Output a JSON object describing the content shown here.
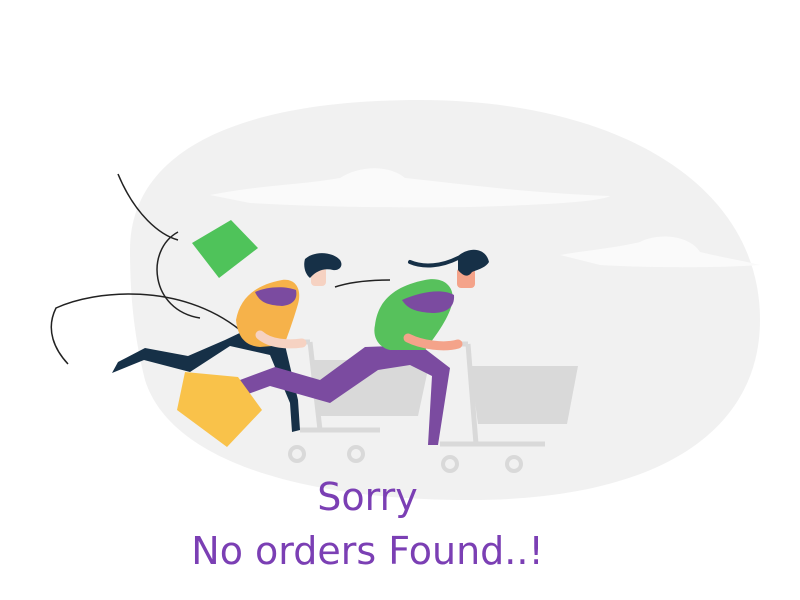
{
  "message": {
    "line1": "Sorry",
    "line2": "No orders Found..!"
  },
  "colors": {
    "accent_text": "#7b3fb4",
    "background_blob": "#f1f1f1",
    "cart": "#d9d9d9",
    "green_shirt": "#57c15c",
    "orange_shirt": "#f6b24a",
    "purple_pants": "#7b4ba0",
    "navy_pants": "#163047",
    "skin": "#f4a38a",
    "yellow_bag": "#f9c24a",
    "green_flyer": "#4fc35a"
  },
  "illustration": {
    "icons": [
      "running-shoppers-illustration",
      "shopping-cart-icon",
      "shopping-bag-icon",
      "flying-paper-icon"
    ]
  }
}
